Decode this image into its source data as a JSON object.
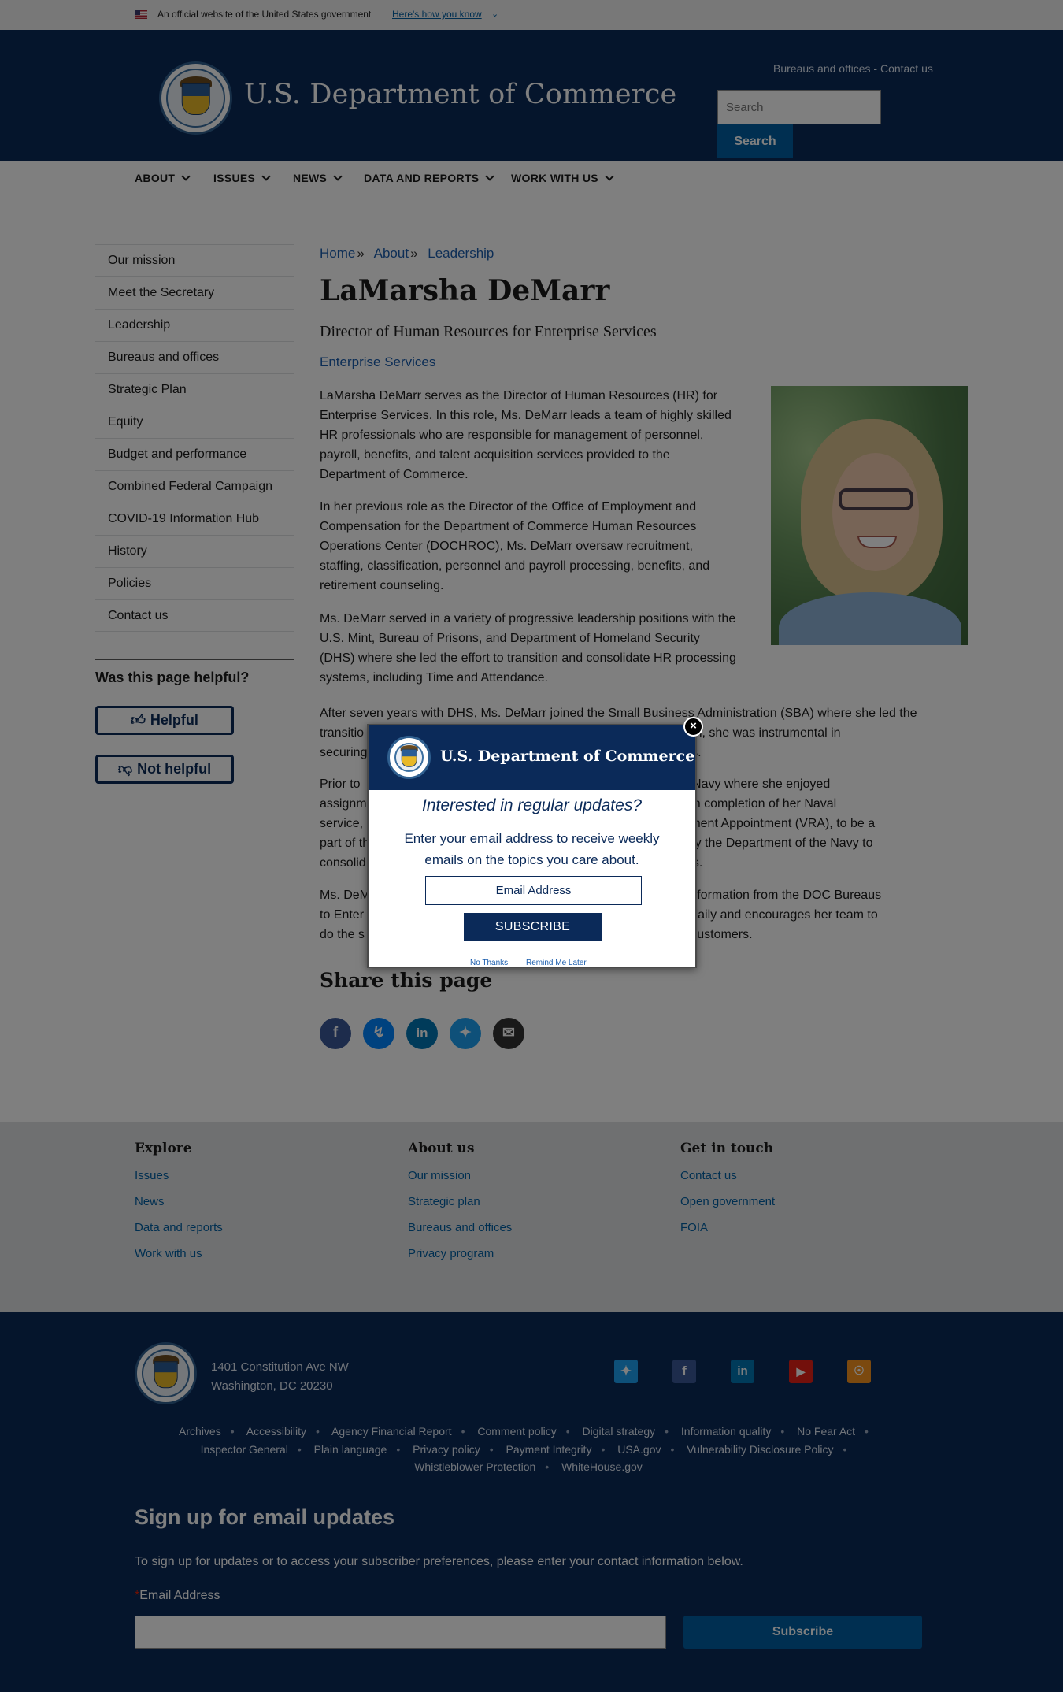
{
  "gov_banner": {
    "official_text": "An official website of the United States government",
    "how_know": "Here's how you know"
  },
  "header": {
    "site_title": "U.S. Department of Commerce",
    "util_links": [
      "Bureaus and offices",
      "Contact us"
    ],
    "util_separator": " - ",
    "search_placeholder": "Search",
    "search_button": "Search"
  },
  "nav": {
    "items": [
      "ABOUT",
      "ISSUES",
      "NEWS",
      "DATA AND REPORTS",
      "WORK WITH US"
    ]
  },
  "sidebar": {
    "items": [
      "Our mission",
      "Meet the Secretary",
      "Leadership",
      "Bureaus and offices",
      "Strategic Plan",
      "Equity",
      "Budget and performance",
      "Combined Federal Campaign",
      "COVID-19 Information Hub",
      "History",
      "Policies",
      "Contact us"
    ],
    "helpful_question": "Was this page helpful?",
    "helpful_button": "Helpful",
    "not_helpful_button": "Not helpful"
  },
  "breadcrumb": [
    "Home",
    "About",
    "Leadership"
  ],
  "breadcrumb_sep": "»",
  "page": {
    "title": "LaMarsha DeMarr",
    "subtitle": "Director of Human Resources for Enterprise Services",
    "org_link": "Enterprise Services",
    "paragraphs": [
      [
        "LaMarsha DeMarr serves as the Director of Human Resources (HR) for",
        "Enterprise Services. In this role, Ms. DeMarr leads a team of highly skilled",
        "HR professionals who are responsible for management of personnel,",
        "payroll, benefits, and talent acquisition services provided to the",
        "Department of Commerce."
      ],
      [
        "In her previous role as the Director of the Office of Employment and",
        "Compensation for the Department of Commerce Human Resources",
        "Operations Center (DOCHROC), Ms. DeMarr oversaw recruitment,",
        "staffing, classification, personnel and payroll processing, benefits, and",
        "retirement counseling."
      ],
      [
        "Ms. DeMarr served in a variety of progressive leadership positions with the",
        "U.S. Mint, Bureau of Prisons, and Department of Homeland Security",
        "(DHS) where she led the effort to transition and consolidate HR processing",
        "systems, including Time and Attendance."
      ],
      [
        "After seven years with DHS, Ms. DeMarr joined the Small Business Administration (SBA) where she led the",
        "transitio                                                                          on. In addition, she was instrumental in",
        "securing                                                                          ice providers."
      ],
      [
        "Prior to                                                                          d in the U.S. Navy where she enjoyed",
        "assignm                                                                          Maine.  Upon completion of her Naval",
        "service,                                                                          rans Recruitment Appointment (VRA), to be a",
        "part of th                                                                          n initiative by the Department of the Navy to",
        "consolid                                                                          rvice Centers."
      ],
      [
        "Ms. DeM                                                                          ctional transformation from the DOC Bureaus",
        "to Enter                                                                          vices Ethos daily and encourages her team to",
        "do the s                                                                          her and the customers."
      ]
    ],
    "share_title": "Share this page"
  },
  "share_icons": [
    "facebook-icon",
    "messenger-icon",
    "linkedin-icon",
    "twitter-icon",
    "email-icon"
  ],
  "footer": {
    "explore_heading": "Explore",
    "explore_links": [
      "Issues",
      "News",
      "Data and reports",
      "Work with us"
    ],
    "about_heading": "About us",
    "about_links": [
      "Our mission",
      "Strategic plan",
      "Bureaus and offices",
      "Privacy program"
    ],
    "contact_heading": "Get in touch",
    "contact_links": [
      "Contact us",
      "Open government",
      "FOIA"
    ],
    "address_line1": "1401 Constitution Ave NW",
    "address_line2": "Washington, DC 20230",
    "social_icons": [
      "twitter-icon",
      "facebook-icon",
      "linkedin-icon",
      "youtube-icon",
      "rss-icon"
    ],
    "legal_row1": [
      "Archives",
      "Accessibility",
      "Agency Financial Report",
      "Comment policy",
      "Digital strategy",
      "Information quality",
      "No Fear Act"
    ],
    "legal_row2": [
      "Inspector General",
      "Plain language",
      "Privacy policy",
      "Payment Integrity",
      "USA.gov",
      "Vulnerability Disclosure Policy"
    ],
    "legal_row3": [
      "Whistleblower Protection",
      "WhiteHouse.gov"
    ],
    "signup_title": "Sign up for email updates",
    "signup_desc": "To sign up for updates or to access your subscriber preferences, please enter your contact information below.",
    "email_required_mark": "*",
    "email_label": "Email Address",
    "signup_button": "Subscribe"
  },
  "modal": {
    "title": "U.S. Department of Commerce",
    "question": "Interested in regular updates?",
    "description": "Enter your email address to receive weekly emails on the topics you care about.",
    "email_placeholder": "Email Address",
    "subscribe_button": "SUBSCRIBE",
    "no_thanks": "No Thanks",
    "remind_later": "Remind Me Later",
    "close_symbol": "×"
  },
  "colors": {
    "navy": "#0b2a59",
    "link_blue": "#005ea2",
    "footer_gray": "#dfe1e2"
  }
}
